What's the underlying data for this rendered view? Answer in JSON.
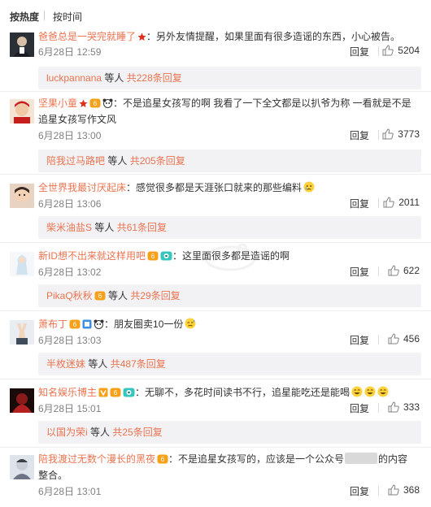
{
  "sort": {
    "hot": "按热度",
    "time": "按时间"
  },
  "colors": {
    "accent": "#eb7350",
    "meta": "#808080",
    "sub_bg": "#f2f2f5"
  },
  "comments": [
    {
      "user": "爸爸总是一哭完就睡了",
      "badges": [
        "star-icon"
      ],
      "text": "：另外友情提醒，如果里面有很多造谣的东西，小心被告。",
      "time": "6月28日 12:59",
      "reply": "回复",
      "likes": "5204",
      "sub": {
        "user": "luckpannana",
        "mid": " 等人 ",
        "count": "共228条回复"
      }
    },
    {
      "user": "坚果小童",
      "badges": [
        "star-icon",
        "vip-icon",
        "panda-icon"
      ],
      "text": "：不是追星女孩写的啊 我看了一下全文都是以扒爷为称  一看就是不是",
      "text2": "追星女孩写作文风",
      "time": "6月28日 13:00",
      "reply": "回复",
      "likes": "3773",
      "sub": {
        "user": "陪我过马路吧",
        "mid": " 等人 ",
        "count": "共205条回复"
      }
    },
    {
      "user": "全世界我最讨厌起床",
      "badges": [],
      "text": "：感觉很多都是天涯张口就来的那些编料",
      "time": "6月28日 13:06",
      "reply": "回复",
      "likes": "2011",
      "sub": {
        "user": "柴米油盐S",
        "mid": " 等人 ",
        "count": "共61条回复"
      }
    },
    {
      "user": "新ID想不出来就这样用吧",
      "badges": [
        "vip-icon",
        "eye-icon"
      ],
      "text": "：这里面很多都是造谣的啊",
      "time": "6月28日 13:02",
      "reply": "回复",
      "likes": "622",
      "sub": {
        "user": "PikaQ秋秋",
        "mid": " 等人 ",
        "count": "共29条回复"
      }
    },
    {
      "user": "萧布丁",
      "badges": [
        "vip-icon",
        "square-icon",
        "panda-icon"
      ],
      "text": "：朋友圈卖10一份",
      "time": "6月28日 13:03",
      "reply": "回复",
      "likes": "456",
      "sub": {
        "user": "半枚迷妹",
        "mid": " 等人 ",
        "count": "共487条回复"
      }
    },
    {
      "user": "知名娱乐博主",
      "badges": [
        "v-icon",
        "vip-icon",
        "eye-icon"
      ],
      "text": "：无聊不，多花时间读书不行，追星能吃还是能喝",
      "time": "6月28日 15:01",
      "reply": "回复",
      "likes": "333",
      "sub": {
        "user": "以国为荣i",
        "mid": " 等人 ",
        "count": "共25条回复"
      }
    },
    {
      "user": "陪我渡过无数个漫长的黑夜",
      "badges": [
        "vip-icon"
      ],
      "text": "：不是追星女孩写的，应该是一个公众号",
      "text_after": "的内容",
      "text2": "整合。",
      "time": "6月28日 13:01",
      "reply": "回复",
      "likes": "368"
    }
  ]
}
